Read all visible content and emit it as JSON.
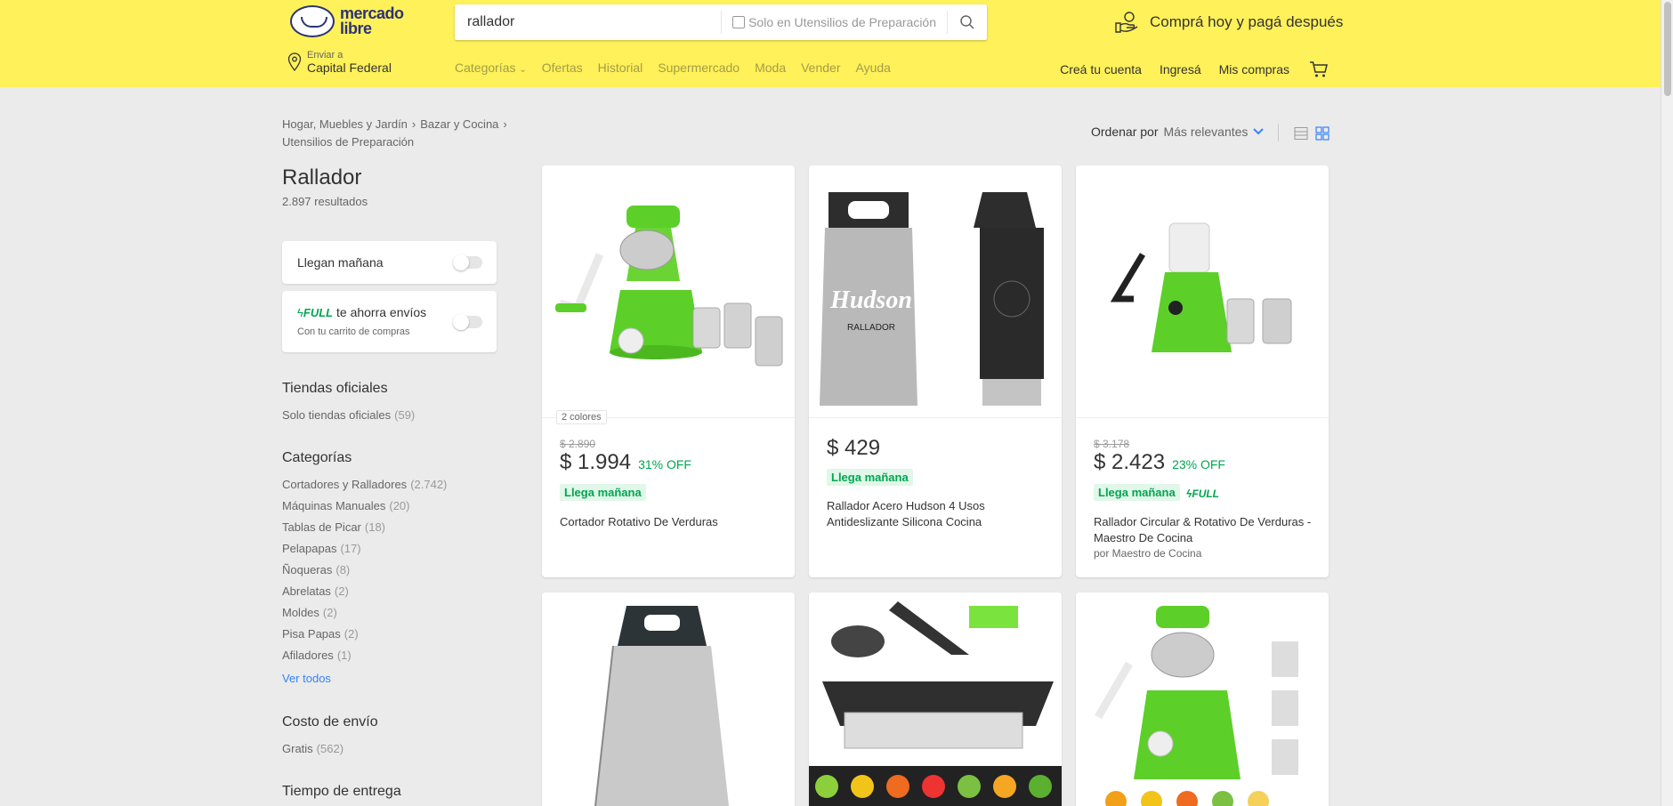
{
  "header": {
    "logo_line1": "mercado",
    "logo_line2": "libre",
    "search_value": "rallador",
    "search_filter_label": "Solo en Utensilios de Preparación",
    "promo": "Comprá hoy y pagá después",
    "location_small": "Enviar a",
    "location_big": "Capital Federal",
    "nav": [
      "Categorías",
      "Ofertas",
      "Historial",
      "Supermercado",
      "Moda",
      "Vender",
      "Ayuda"
    ],
    "user_nav": [
      "Creá tu cuenta",
      "Ingresá",
      "Mis compras"
    ]
  },
  "breadcrumb": [
    "Hogar, Muebles y Jardín",
    "Bazar y Cocina",
    "Utensilios de Preparación"
  ],
  "page": {
    "title": "Rallador",
    "results": "2.897 resultados"
  },
  "filters": {
    "llegan": "Llegan mañana",
    "full_tag": "FULL",
    "full_text": "te ahorra envíos",
    "full_sub": "Con tu carrito de compras",
    "tiendas_title": "Tiendas oficiales",
    "tiendas_item": "Solo tiendas oficiales",
    "tiendas_count": "(59)",
    "categorias_title": "Categorías",
    "categorias": [
      {
        "label": "Cortadores y Ralladores",
        "count": "(2.742)"
      },
      {
        "label": "Máquinas Manuales",
        "count": "(20)"
      },
      {
        "label": "Tablas de Picar",
        "count": "(18)"
      },
      {
        "label": "Pelapapas",
        "count": "(17)"
      },
      {
        "label": "Ñoqueras",
        "count": "(8)"
      },
      {
        "label": "Abrelatas",
        "count": "(2)"
      },
      {
        "label": "Moldes",
        "count": "(2)"
      },
      {
        "label": "Pisa Papas",
        "count": "(2)"
      },
      {
        "label": "Afiladores",
        "count": "(1)"
      }
    ],
    "ver_todos": "Ver todos",
    "envio_title": "Costo de envío",
    "envio_item": "Gratis",
    "envio_count": "(562)",
    "entrega_title": "Tiempo de entrega"
  },
  "sort": {
    "label": "Ordenar por",
    "value": "Más relevantes"
  },
  "products": [
    {
      "colors": "2 colores",
      "old_price": "$ 2.890",
      "price": "$ 1.994",
      "discount": "31% OFF",
      "ship": "Llega mañana",
      "title": "Cortador Rotativo De Verduras"
    },
    {
      "price": "$ 429",
      "ship": "Llega mañana",
      "title": "Rallador Acero Hudson 4 Usos Antideslizante Silicona Cocina",
      "brand": "Hudson",
      "brand_sub": "RALLADOR"
    },
    {
      "old_price": "$ 3.178",
      "price": "$ 2.423",
      "discount": "23% OFF",
      "ship": "Llega mañana",
      "full": "FULL",
      "title": "Rallador Circular & Rotativo De Verduras - Maestro De Cocina",
      "seller": "por Maestro de Cocina"
    }
  ],
  "colors": {
    "header_bg": "#fff159",
    "accent": "#3483fa",
    "green": "#00a650"
  }
}
